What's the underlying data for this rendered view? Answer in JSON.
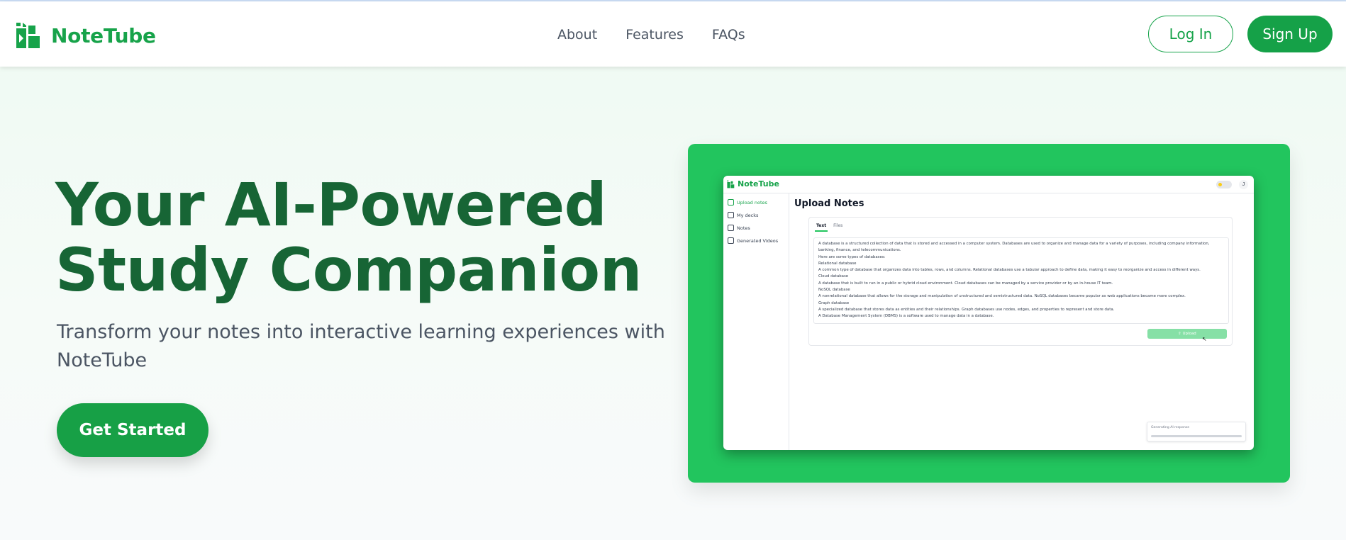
{
  "brand": {
    "name": "NoteTube",
    "logo_icon": "notetube-logo-icon",
    "color": "#17a34a"
  },
  "nav": {
    "items": [
      {
        "label": "About"
      },
      {
        "label": "Features"
      },
      {
        "label": "FAQs"
      }
    ]
  },
  "auth": {
    "login_label": "Log In",
    "signup_label": "Sign Up"
  },
  "hero": {
    "title_line1": "Your AI-Powered",
    "title_line2": "Study Companion",
    "subtitle": "Transform your notes into interactive learning experiences with NoteTube",
    "cta_label": "Get Started",
    "title_color": "#176535",
    "accent": "#22c55e"
  },
  "preview": {
    "brand": "NoteTube",
    "avatar": "J",
    "sidebar": [
      {
        "label": "Upload notes",
        "icon": "upload-icon"
      },
      {
        "label": "My decks",
        "icon": "deck-icon"
      },
      {
        "label": "Notes",
        "icon": "notes-icon"
      },
      {
        "label": "Generated Videos",
        "icon": "video-icon"
      }
    ],
    "page_title": "Upload Notes",
    "tabs": [
      {
        "label": "Text"
      },
      {
        "label": "Files"
      }
    ],
    "text_lines": [
      "A database is a structured collection of data that is stored and accessed in a computer system. Databases are used to organize and manage data for a variety of purposes, including company information,",
      "banking, finance, and telecommunications.",
      "Here are some types of databases:",
      "Relational database",
      "A common type of database that organizes data into tables, rows, and columns. Relational databases use a tabular approach to define data, making it easy to reorganize and access in different ways.",
      "Cloud database",
      "A database that is built to run in a public or hybrid cloud environment. Cloud databases can be managed by a service provider or by an in-house IT team.",
      "NoSQL database",
      "A nonrelational database that allows for the storage and manipulation of unstructured and semistructured data. NoSQL databases became popular as web applications became more complex.",
      "Graph database",
      "A specialized database that stores data as entities and their relationships. Graph databases use nodes, edges, and properties to represent and store data.",
      "A Database Management System (DBMS) is a software used to manage data in a database."
    ],
    "upload_label": "Upload",
    "toast_text": "Generating AI response"
  }
}
